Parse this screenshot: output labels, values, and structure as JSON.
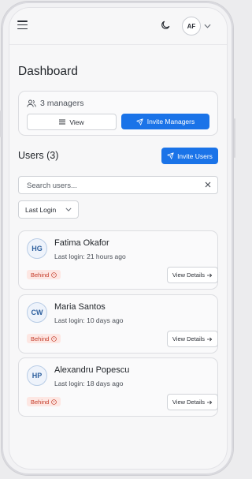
{
  "header": {
    "menu_icon": "hamburger-icon",
    "theme_icon": "moon-icon",
    "avatar_initials": "AF",
    "avatar_chevron": "chevron-down-icon"
  },
  "page": {
    "title": "Dashboard"
  },
  "managers": {
    "count_label": "3 managers",
    "icon": "users-icon",
    "view_label": "View",
    "view_icon": "list-icon",
    "invite_label": "Invite Managers",
    "invite_icon": "send-icon"
  },
  "users": {
    "heading": "Users (3)",
    "invite_label": "Invite Users",
    "search_placeholder": "Search users...",
    "sort_value": "Last Login",
    "list": [
      {
        "initials": "HG",
        "name": "Fatima Okafor",
        "last_login": "Last login: 21 hours ago",
        "status": "Behind",
        "action": "View Details"
      },
      {
        "initials": "CW",
        "name": "Maria Santos",
        "last_login": "Last login: 10 days ago",
        "status": "Behind",
        "action": "View Details"
      },
      {
        "initials": "HP",
        "name": "Alexandru Popescu",
        "last_login": "Last login: 18 days ago",
        "status": "Behind",
        "action": "View Details"
      }
    ]
  },
  "colors": {
    "accent": "#1a73e8",
    "status_behind_bg": "#fde7e3",
    "status_behind_text": "#c43d2b"
  }
}
